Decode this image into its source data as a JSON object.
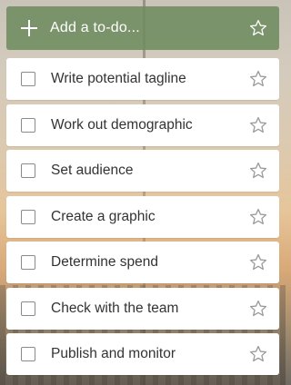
{
  "add_bar": {
    "label": "Add a to-do...",
    "icon": "plus-icon",
    "star_icon": "star-outline-icon"
  },
  "colors": {
    "add_bar_bg": "#6e8c5f",
    "add_bar_text": "#ffffff",
    "item_bg": "#ffffff",
    "item_text": "#333333",
    "checkbox_border": "#8a8a8a",
    "star_outline": "#9a9a9a"
  },
  "todos": [
    {
      "title": "Write potential tagline",
      "completed": false,
      "starred": false
    },
    {
      "title": "Work out demographic",
      "completed": false,
      "starred": false
    },
    {
      "title": "Set audience",
      "completed": false,
      "starred": false
    },
    {
      "title": "Create a graphic",
      "completed": false,
      "starred": false
    },
    {
      "title": "Determine spend",
      "completed": false,
      "starred": false
    },
    {
      "title": "Check with the team",
      "completed": false,
      "starred": false
    },
    {
      "title": "Publish and monitor",
      "completed": false,
      "starred": false
    }
  ]
}
